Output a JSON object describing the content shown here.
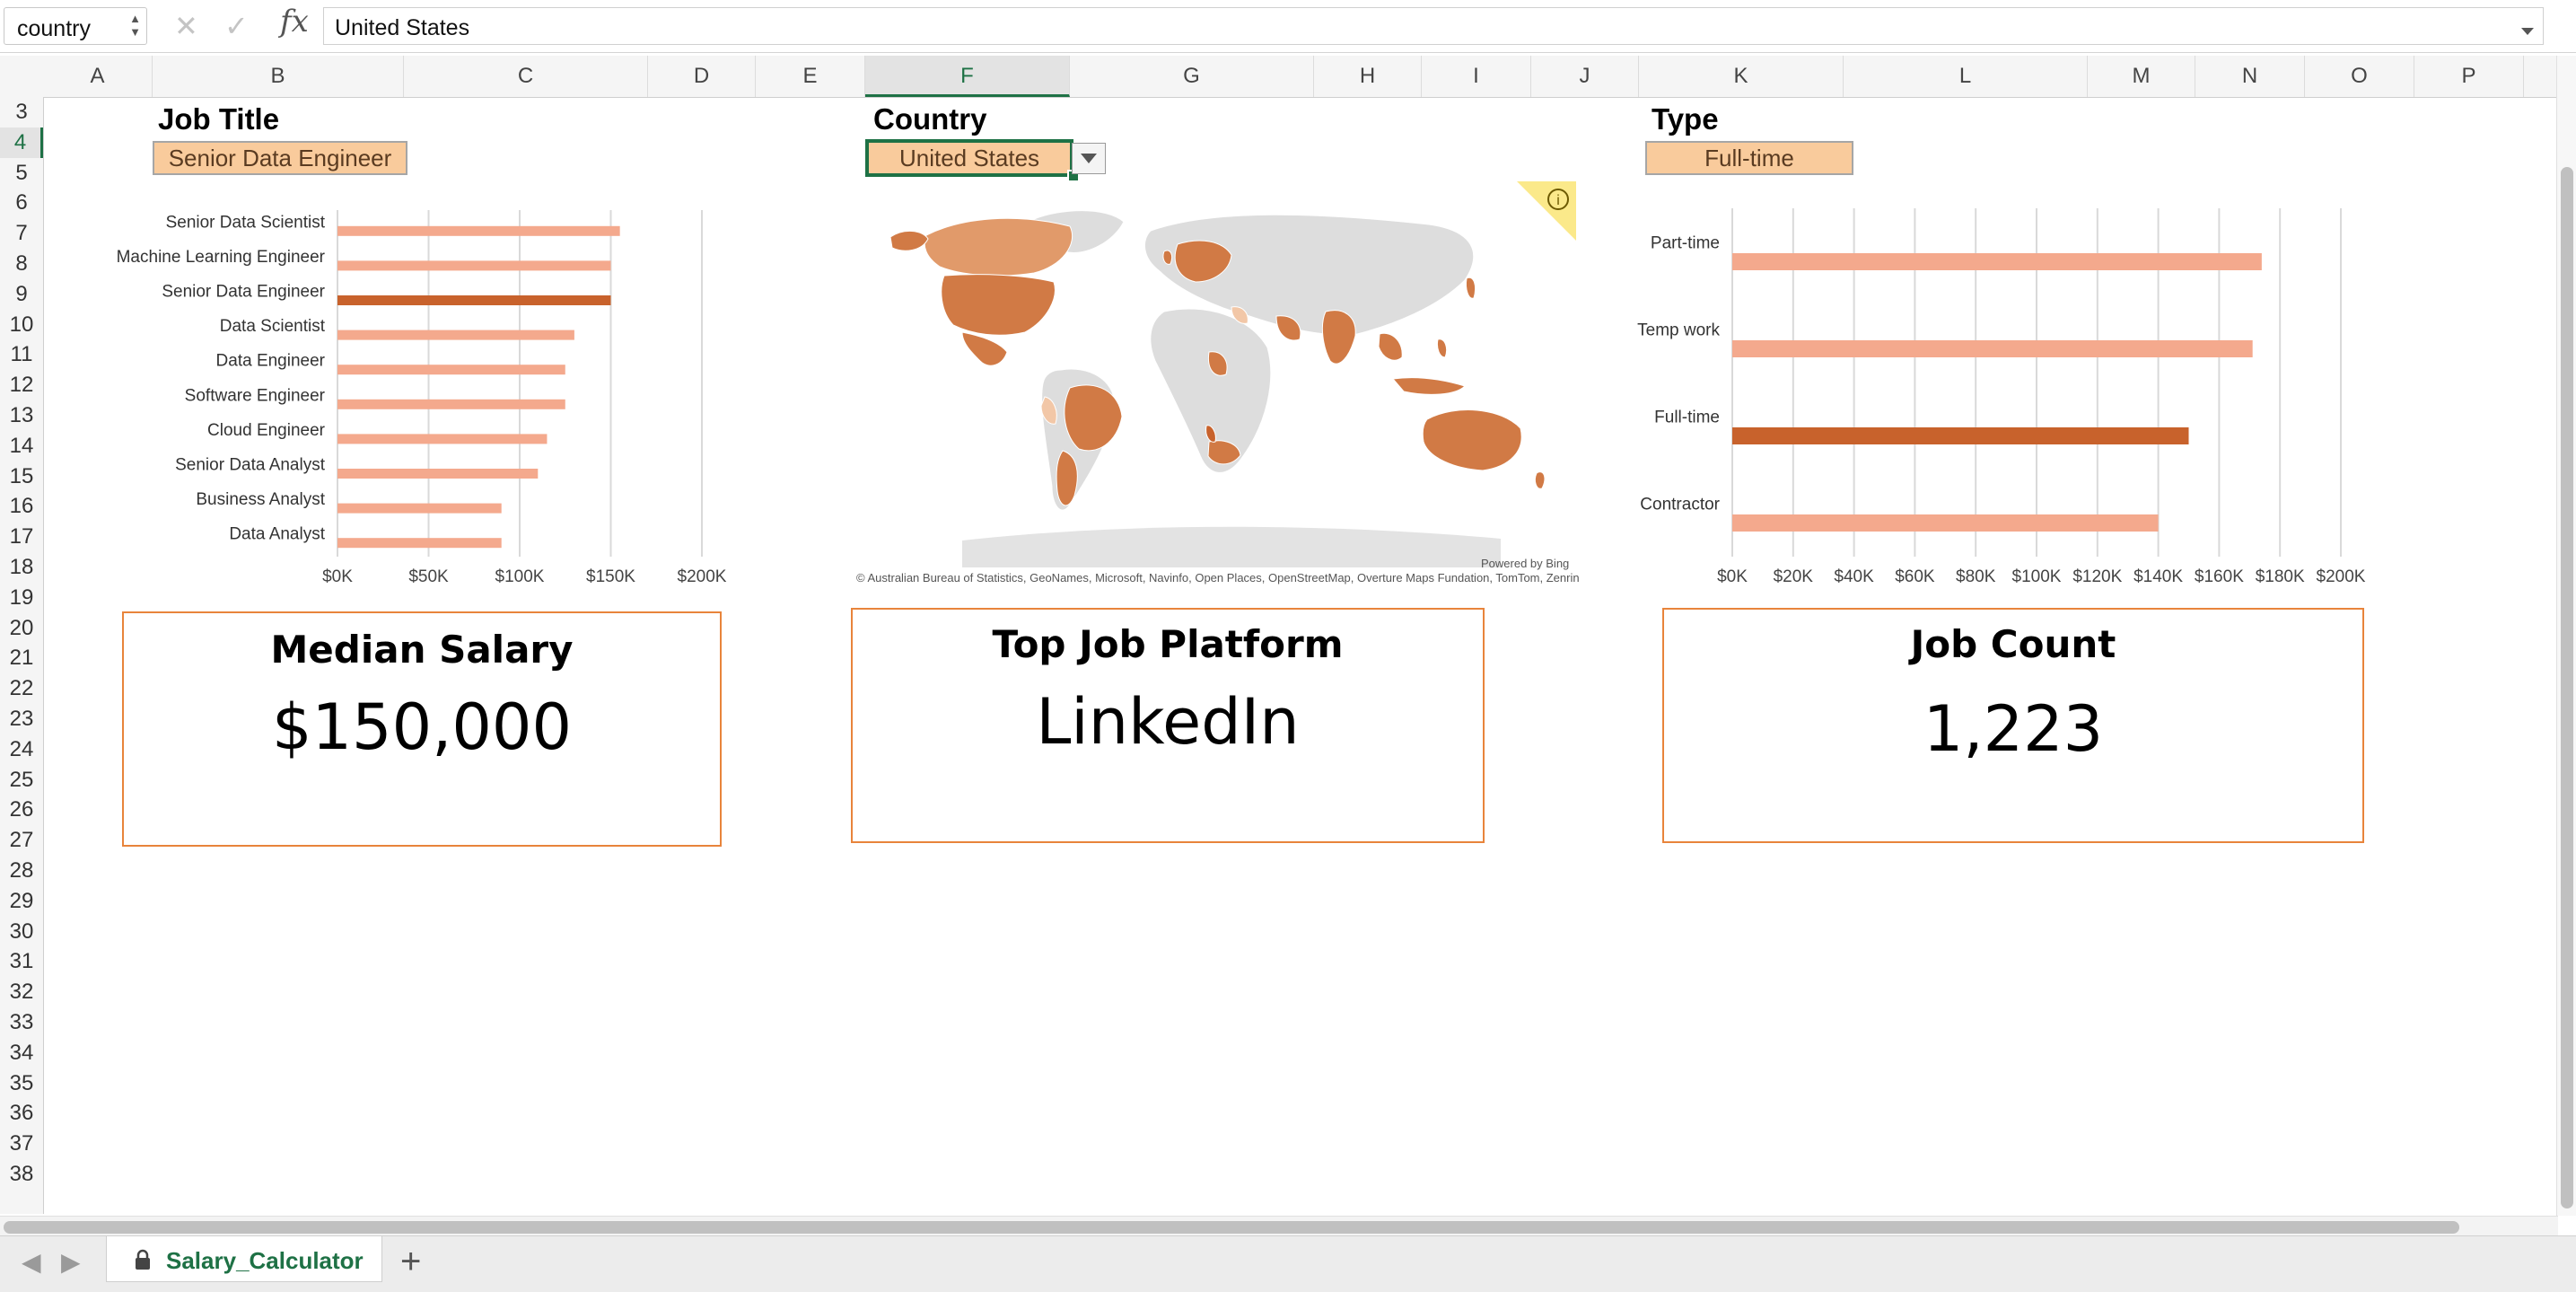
{
  "formula_bar": {
    "name_box": "country",
    "formula": "United States"
  },
  "columns": [
    "A",
    "B",
    "C",
    "D",
    "E",
    "F",
    "G",
    "H",
    "I",
    "J",
    "K",
    "L",
    "M",
    "N",
    "O",
    "P"
  ],
  "rows": [
    "3",
    "4",
    "5",
    "6",
    "7",
    "8",
    "9",
    "10",
    "11",
    "12",
    "13",
    "14",
    "15",
    "16",
    "17",
    "18",
    "19",
    "20",
    "21",
    "22",
    "23",
    "24",
    "25",
    "26",
    "27",
    "28",
    "29",
    "30",
    "31",
    "32",
    "33",
    "34",
    "35",
    "36",
    "37",
    "38"
  ],
  "selected_column": "F",
  "selected_row": "4",
  "slicers": {
    "job_title": {
      "heading": "Job Title",
      "value": "Senior Data Engineer"
    },
    "country": {
      "heading": "Country",
      "value": "United States"
    },
    "type": {
      "heading": "Type",
      "value": "Full-time"
    }
  },
  "colors": {
    "bar": "#f4a98d",
    "bar_highlight": "#c8622c",
    "selector_fill": "#f9cb9c",
    "card_border": "#e8843b",
    "selection_green": "#1e7145",
    "map_land": "#dddddd",
    "map_dark": "#d17a45",
    "map_mid": "#e19a6a",
    "map_light": "#f2c7a7"
  },
  "chart_data": [
    {
      "type": "bar",
      "orientation": "horizontal",
      "categories": [
        "Senior Data Scientist",
        "Machine Learning Engineer",
        "Senior Data Engineer",
        "Data Scientist",
        "Data Engineer",
        "Software Engineer",
        "Cloud Engineer",
        "Senior Data Analyst",
        "Business Analyst",
        "Data Analyst"
      ],
      "values": [
        155000,
        150000,
        150000,
        130000,
        125000,
        125000,
        115000,
        110000,
        90000,
        90000
      ],
      "highlight": "Senior Data Engineer",
      "xlim": [
        0,
        200000
      ],
      "ticks": [
        "$0K",
        "$50K",
        "$100K",
        "$150K",
        "$200K"
      ],
      "grid": "vertical"
    },
    {
      "type": "bar",
      "orientation": "horizontal",
      "categories": [
        "Part-time",
        "Temp work",
        "Full-time",
        "Contractor"
      ],
      "values": [
        174000,
        171000,
        150000,
        140000
      ],
      "highlight": "Full-time",
      "xlim": [
        0,
        200000
      ],
      "ticks": [
        "$0K",
        "$20K",
        "$40K",
        "$60K",
        "$80K",
        "$100K",
        "$120K",
        "$140K",
        "$160K",
        "$180K",
        "$200K"
      ],
      "grid": "vertical"
    }
  ],
  "map": {
    "attribution": "© Australian Bureau of Statistics, GeoNames, Microsoft, Navinfo, Open Places, OpenStreetMap, Overture Maps Fundation, TomTom, Zenrin",
    "powered_by": "Powered by Bing",
    "info_icon": "i"
  },
  "cards": {
    "median_salary": {
      "title": "Median Salary",
      "value": "$150,000"
    },
    "top_platform": {
      "title": "Top Job Platform",
      "value": "LinkedIn"
    },
    "job_count": {
      "title": "Job Count",
      "value": "1,223"
    }
  },
  "sheet_tabs": {
    "active": "Salary_Calculator",
    "add": "+"
  }
}
